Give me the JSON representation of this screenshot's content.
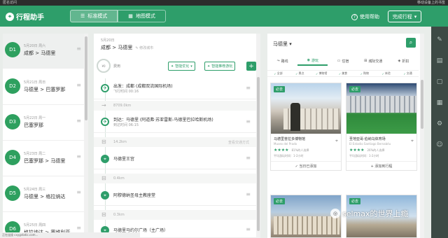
{
  "titlebar": {
    "left": "匿名访问",
    "right": "移动设备上的书签"
  },
  "header": {
    "logo": "行程助手",
    "modes": [
      {
        "label": "标准模式",
        "icon": "list-icon"
      },
      {
        "label": "地图模式",
        "icon": "map-icon"
      }
    ],
    "help": "使用帮助",
    "finish": "完成行程"
  },
  "days": [
    {
      "code": "D1",
      "date": "5月20日 周六",
      "route": "成都 > 马德里"
    },
    {
      "code": "D2",
      "date": "5月21日 周日",
      "route": "马德里 > 巴塞罗那"
    },
    {
      "code": "D3",
      "date": "5月22日 周一",
      "route": "巴塞罗那"
    },
    {
      "code": "D4",
      "date": "5月23日 周二",
      "route": "巴塞罗那 > 马德里"
    },
    {
      "code": "D5",
      "date": "5月24日 周三",
      "route": "马德里 > 格拉纳达"
    },
    {
      "code": "D6",
      "date": "5月25日 周四",
      "route": "格拉纳达 > 塞维利亚"
    }
  ],
  "route": {
    "date": "5月20日",
    "title": "成都 > 马德里",
    "modify": "修改城市",
    "budget_ring": "¥0",
    "budget_label": "费用",
    "optimize": "智能优化",
    "fill": "智能推荐游玩",
    "add": "+",
    "stops": [
      {
        "type": "plane",
        "icon": "plane-icon",
        "t1": "出发：成都 (成都双流国际机场)",
        "t2": "飞行时间 00:16"
      },
      {
        "type": "plane",
        "icon": "plane-icon",
        "t1": "到达：马德里 (阿道弗·苏亚雷斯-马德里巴拉哈斯机场)",
        "t2": "到达时间 06:15"
      },
      {
        "type": "poi",
        "icon": "pin-icon",
        "t1": "马德里王宫",
        "t2": ""
      },
      {
        "type": "poi",
        "icon": "pin-icon",
        "t1": "阿穆德纳圣母主教座堂",
        "t2": ""
      },
      {
        "type": "poi",
        "icon": "pin-icon",
        "t1": "马德里马约尔广场（主广场）",
        "t2": ""
      }
    ],
    "distances": [
      {
        "km": "8709.0km",
        "note": ""
      },
      {
        "km": "14.2km",
        "note": "查看交通方式"
      },
      {
        "km": "0.4km",
        "note": ""
      },
      {
        "km": "0.3km",
        "note": ""
      }
    ]
  },
  "search": {
    "city": "马德里",
    "categories": [
      {
        "label": "路线",
        "icon": "route-icon"
      },
      {
        "label": "游玩",
        "icon": "camera-icon"
      },
      {
        "label": "住宿",
        "icon": "bed-icon"
      },
      {
        "label": "城际交通",
        "icon": "bus-icon"
      },
      {
        "label": "折扣",
        "icon": "tag-icon"
      }
    ],
    "filters": [
      "全部",
      "景点",
      "博物馆",
      "美食",
      "购物",
      "体验",
      "交通"
    ],
    "cards": [
      {
        "tag": "必去",
        "name": "马德里普拉多博物馆",
        "ename": "Museo del Prado",
        "stars": "★★★★",
        "pct": "81%的人选择",
        "dur": "平均游玩时间：1-2小时",
        "add": "+ 添加到行程"
      },
      {
        "tag": "必去",
        "name": "圣地亚哥·伯纳乌体育场",
        "ename": "El Estadio Santiago Bernabéu",
        "stars": "★★★★",
        "pct": "26%的人选择",
        "dur": "平均游玩时间：1-2小时",
        "add": "+ 添加到行程"
      },
      {
        "tag": "必去",
        "name": "",
        "ename": "",
        "stars": "",
        "pct": "",
        "dur": "",
        "add": ""
      },
      {
        "tag": "必去",
        "name": "",
        "ename": "",
        "stars": "",
        "pct": "",
        "dur": "",
        "add": ""
      }
    ],
    "card_state_first": "✓ 当日已添加"
  },
  "statusbar": "正在连接 cxygstatic.com...",
  "watermark": "selmax的世界上瘾",
  "colors": {
    "primary": "#2e9e6a",
    "sidebar": "#3d4a45"
  }
}
